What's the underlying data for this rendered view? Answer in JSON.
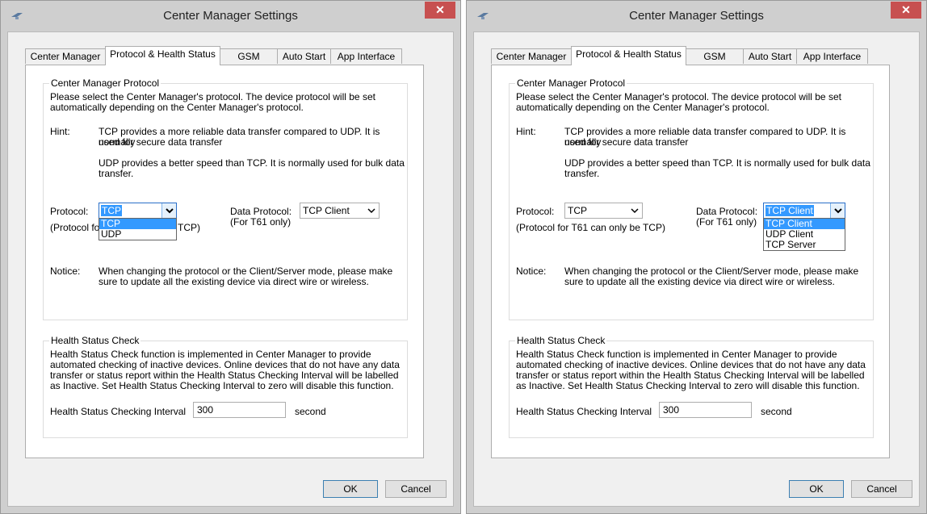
{
  "windows": [
    {
      "title": "Center Manager Settings",
      "close_glyph": "✕",
      "tabs": [
        "Center Manager",
        "Protocol & Health Status",
        "GSM Modem",
        "Auto Start",
        "App Interface"
      ],
      "active_tab": "Protocol & Health Status",
      "protocol_group": {
        "legend": "Center Manager Protocol",
        "description_lines": [
          "Please select the Center Manager's protocol. The device protocol will be set",
          "automatically depending on the Center Manager's protocol."
        ],
        "hint_label": "Hint:",
        "hint_tcp_lines": [
          "TCP provides a more reliable data transfer compared to UDP. It is normally",
          "used for secure data transfer"
        ],
        "hint_udp_lines": [
          "UDP provides a better speed than TCP. It is normally used for bulk data",
          "transfer."
        ],
        "protocol_label": "Protocol:",
        "protocol_value": "TCP",
        "protocol_note": "(Protocol for T61 can only be TCP)",
        "data_protocol_label": "Data Protocol:",
        "data_protocol_note": "(For T61 only)",
        "data_protocol_value": "TCP Client",
        "notice_label": "Notice:",
        "notice_lines": [
          "When changing the protocol or the Client/Server mode, please make",
          "sure to update all the existing device via direct wire or wireless."
        ]
      },
      "health_group": {
        "legend": "Health Status Check",
        "description_lines": [
          "Health Status Check function is implemented in Center Manager to provide",
          "automated checking of inactive devices. Online devices that do not have any data",
          "transfer or status report within the Health Status Checking Interval will be labelled",
          "as Inactive. Set Health Status Checking Interval to zero will disable this function."
        ],
        "interval_label": "Health Status Checking Interval",
        "interval_value": "300",
        "interval_unit": "second"
      },
      "ok_label": "OK",
      "cancel_label": "Cancel",
      "open_dropdown": {
        "field": "protocol",
        "options": [
          "TCP",
          "UDP"
        ],
        "highlighted": "TCP",
        "note_visible_fragments": [
          "(Protocol fo",
          "TCP)"
        ]
      }
    },
    {
      "title": "Center Manager Settings",
      "close_glyph": "✕",
      "tabs": [
        "Center Manager",
        "Protocol & Health Status",
        "GSM Modem",
        "Auto Start",
        "App Interface"
      ],
      "active_tab": "Protocol & Health Status",
      "protocol_group": {
        "legend": "Center Manager Protocol",
        "description_lines": [
          "Please select the Center Manager's protocol. The device protocol will be set",
          "automatically depending on the Center Manager's protocol."
        ],
        "hint_label": "Hint:",
        "hint_tcp_lines": [
          "TCP provides a more reliable data transfer compared to UDP. It is normally",
          "used for secure data transfer"
        ],
        "hint_udp_lines": [
          "UDP provides a better speed than TCP. It is normally used for bulk data",
          "transfer."
        ],
        "protocol_label": "Protocol:",
        "protocol_value": "TCP",
        "protocol_note": "(Protocol for T61 can only be TCP)",
        "data_protocol_label": "Data Protocol:",
        "data_protocol_note": "(For T61 only)",
        "data_protocol_value": "TCP Client",
        "notice_label": "Notice:",
        "notice_lines": [
          "When changing the protocol or the Client/Server mode, please make",
          "sure to update all the existing device via direct wire or wireless."
        ]
      },
      "health_group": {
        "legend": "Health Status Check",
        "description_lines": [
          "Health Status Check function is implemented in Center Manager to provide",
          "automated checking of inactive devices. Online devices that do not have any data",
          "transfer or status report within the Health Status Checking Interval will be labelled",
          "as Inactive. Set Health Status Checking Interval to zero will disable this function."
        ],
        "interval_label": "Health Status Checking Interval",
        "interval_value": "300",
        "interval_unit": "second"
      },
      "ok_label": "OK",
      "cancel_label": "Cancel",
      "open_dropdown": {
        "field": "data_protocol",
        "options": [
          "TCP Client",
          "UDP Client",
          "TCP Server"
        ],
        "highlighted": "TCP Client"
      }
    }
  ],
  "colors": {
    "close_button": "#c75050",
    "selection": "#3399ff",
    "chrome": "#cfcfcf",
    "dialog": "#f0f0f0"
  }
}
